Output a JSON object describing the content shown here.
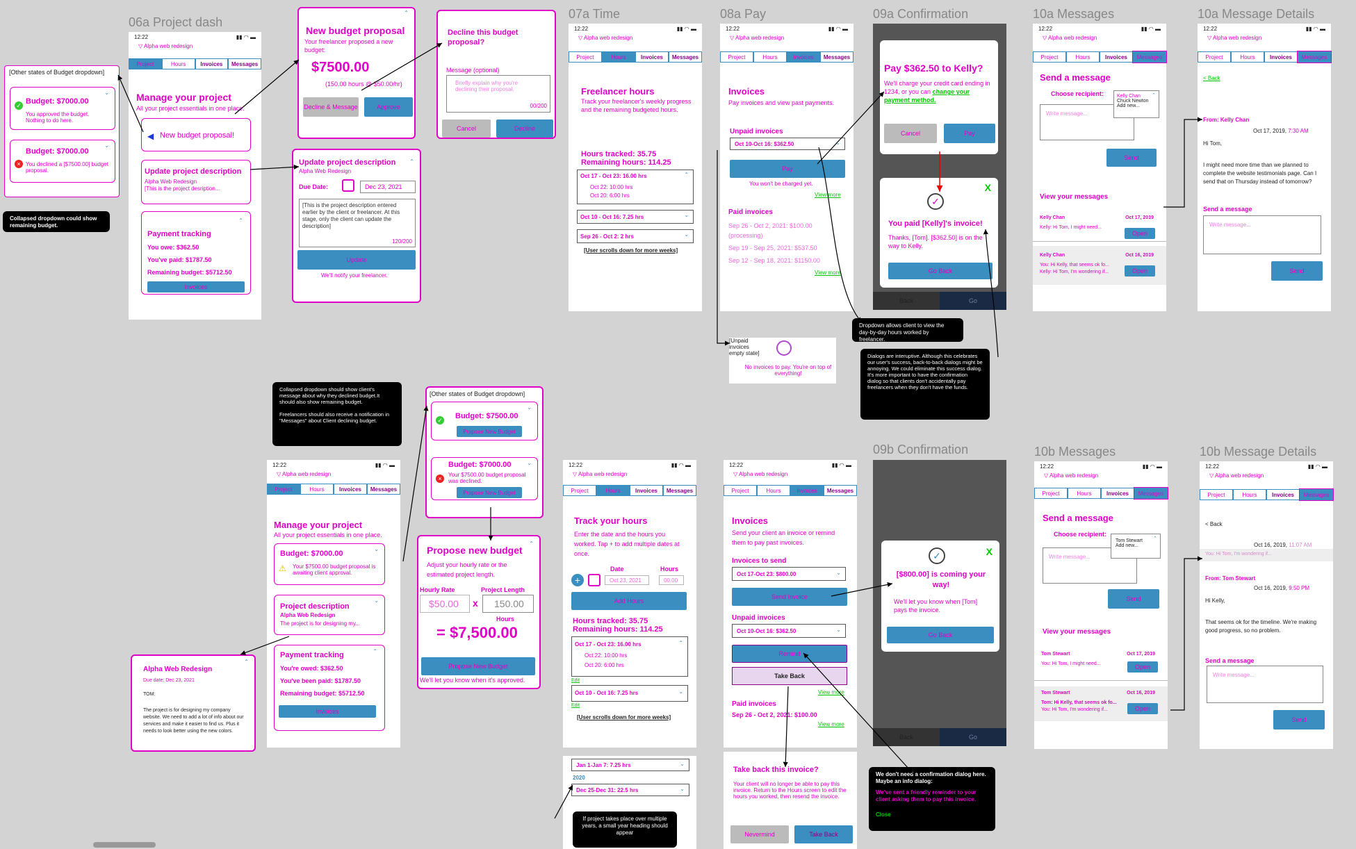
{
  "frames": {
    "f06a": "06a Project dash",
    "f07a": "07a Time",
    "f08a": "08a Pay",
    "f09a": "09a Confirmation",
    "f10a_msg": "10a Messages",
    "f10a_det": "10a Message Details",
    "f09b": "09b Confirmation",
    "f10b_msg": "10b Messages",
    "f10b_det": "10b Message Details"
  },
  "common": {
    "time": "12:22",
    "project": "Alpha web redesign",
    "project_cap": "Alpha Web Redesign",
    "tab_project": "Project",
    "tab_hours": "Hours",
    "tab_invoices": "Invoices",
    "tab_messages": "Messages"
  },
  "budget_states": {
    "title": "[Other states of Budget dropdown]",
    "b1": "Budget: $7000.00",
    "b1_msg": "You approved the budget. Nothing to do here.",
    "b2": "Budget: $7000.00",
    "b2_msg": "You declined a [$7500.00] budget proposal.",
    "note": "Collapsed dropdown could show remaining budget."
  },
  "dash": {
    "title": "Manage your project",
    "sub": "All your project essentials in one place.",
    "new_budget": "New budget proposal!",
    "update_title": "Update project description",
    "update_sub": "Alpha Web Redesign",
    "update_desc": "[This is the project desription...",
    "pay_title": "Payment tracking",
    "you_owe": "You owe: $362.50",
    "you_paid": "You've paid: $1787.50",
    "remaining": "Remaining budget: $5712.50",
    "invoices_btn": "Invoices"
  },
  "nbp": {
    "title": "New budget proposal",
    "sub": "Your freelancer proposed a new budget:",
    "amount": "$7500.00",
    "detail": "(150.00 hours @ $50.00/hr)",
    "decline": "Decline & Message",
    "approve": "Approve"
  },
  "decline": {
    "title": "Decline this budget proposal?",
    "label": "Message (optional)",
    "placeholder": "Briefly explain why you're declining their proposal.",
    "count": "00/200",
    "cancel": "Cancel",
    "decline": "Decline"
  },
  "upd": {
    "title": "Update project description",
    "sub": "Alpha Web Redesign",
    "due_label": "Due Date:",
    "due": "Dec 23, 2021",
    "desc": "[This is the project description entered earlier by the client or freelancer. At this stage, only the client can update the description]",
    "count": "120/200",
    "btn": "Update",
    "foot": "We'll notify your freelancer."
  },
  "time_a": {
    "title": "Freelancer hours",
    "sub": "Track your freelancer's weekly progress and the remaining budgeted hours.",
    "tracked": "Hours tracked: 35.75",
    "remaining": "Remaining hours: 114.25",
    "w1": "Oct 17 - Oct 23: 16.00 hrs",
    "w1a": "Oct 22: 10:00 hrs",
    "w1b": "Oct 20:  6:00 hrs",
    "w2": "Oct 10 - Oct 16:  7.25 hrs",
    "w3": "Sep 26 - Oct 2:  2 hrs",
    "scroll": "[User scrolls down for more weeks]"
  },
  "pay_a": {
    "title": "Invoices",
    "sub": "Pay invoices and view past payments.",
    "unpaid": "Unpaid invoices",
    "sel": "Oct 10-Oct 16: $362.50",
    "pay": "Pay",
    "nocharge": "You won't be charged yet.",
    "viewmore": "View more",
    "paid": "Paid invoices",
    "p1": "Sep 26 - Oct 2, 2021: $100.00",
    "p1b": "(processing)",
    "p2": "Sep 19 - Sep 25, 2021: $537.50",
    "p3": "Sep 12 - Sep 18, 2021: $1150.00",
    "viewmore2": "View more"
  },
  "empty": {
    "label": "[Unpaid invoices empty state]",
    "msg": "No invoices to pay. You're on top of everything!"
  },
  "conf_a": {
    "title": "Pay $362.50 to Kelly?",
    "body": "We'll charge your credit card ending in 1234, or you can",
    "link": "change your payment method.",
    "cancel": "Cancel",
    "pay": "Pay",
    "x": "X",
    "paid_title": "You paid [Kelly]'s invoice!",
    "paid_body": "Thanks, [Tom]. [$362.50] is on the way to Kelly.",
    "goback": "Go Back",
    "back": "Back",
    "go": "Go"
  },
  "note_dd": "Dropdown allows client to view the day-by-day hours worked by freelancer.",
  "note_dialogs": "Dialogs are interuptive. Although this celebrates our user's success, back-to-back dialogs might be annoying. We could eliminate this success dialog. It's more important to have the confirmation dialog so that clients don't accidentally pay freelancers when they don't have the funds.",
  "msg_a": {
    "title": "Send a message",
    "choose": "Choose recipient:",
    "placeholder": "Write message...",
    "r1": "Kelly Chan",
    "r2": "Chuck Newton",
    "r3": "Add new...",
    "send": "Send",
    "view": "View your messages",
    "m1_name": "Kelly Chan",
    "m1_date": "Oct 17, 2019",
    "m1_text": "Kelly: Hi Tom, I might need...",
    "open": "Open",
    "m2_name": "Kelly Chan",
    "m2_date": "Oct 16, 2019",
    "m2_a": "You: Hi Kelly, that seems ok fo...",
    "m2_b": "Kelly: Hi Tom, I'm wondering if..."
  },
  "det_a": {
    "back": "< Back",
    "from": "From: Kelly Chan",
    "date": "Oct 17, 2019,",
    "time": "7:30 AM",
    "greet": "Hi Tom,",
    "body": "I might need more time than we planned to complete the website testimonials page. Can I send that on Thursday instead of tomorrow?",
    "send_title": "Send a message",
    "placeholder": "Write message...",
    "send": "Send"
  },
  "note_collapsed": "Collapsed dropdown should show client's message about why they declined budget.It should also show remaining budget.\n\nFreelancers should also receive a notification in \"Messages\" about Client declining budget.",
  "fl_states": {
    "title": "[Other states of Budget dropdown]",
    "b1": "Budget: $7500.00",
    "btn": "Propose New Budget",
    "b2": "Budget: $7000.00",
    "b2_msg": "Your $7500.00 budget proposal was declined."
  },
  "fl_dash": {
    "title": "Manage your project",
    "sub": "All your project essentials in one place.",
    "budget": "Budget: $7000.00",
    "budget_msg": "Your $7500.00 budget proposal is awaiting client approval.",
    "desc_title": "Project description",
    "desc_sub": "Alpha Web Redesign",
    "desc_text": "The project is for designing my...",
    "pay_title": "Payment tracking",
    "owed": "You're owed: $362.50",
    "paid": "You've been paid: $1787.50",
    "remaining": "Remaining budget: $5712.50",
    "invoices": "Invoices"
  },
  "propose": {
    "title": "Propose new budget",
    "sub": "Adjust your hourly rate or the estimated project length.",
    "rate_label": "Hourly Rate",
    "rate": "$50.00",
    "x": "x",
    "len_label": "Project Length",
    "len": "150.00",
    "hours": "Hours",
    "total": "= $7,500.00",
    "btn": "Propose New Budget",
    "foot": "We'll let you know when it's approved."
  },
  "desc_exp": {
    "title": "Alpha Web Redesign",
    "due": "Due date: Dec 23, 2021",
    "tom": "TOM:",
    "body": "The project is for designing my company website. We need to add a lot of info about our services and make it easier to find us. Plus it needs to look better using the new colors."
  },
  "track": {
    "title": "Track your hours",
    "sub": "Enter the date and the hours you worked. Tap + to add multiple dates at once.",
    "date_label": "Date",
    "hours_label": "Hours",
    "date": "Oct 23, 2021",
    "hours": "00.00",
    "add": "Add Hours",
    "tracked": "Hours tracked: 35.75",
    "remaining": "Remaining hours: 114.25",
    "w1": "Oct 17 - Oct 23: 16.00 hrs",
    "w1a": "Oct 22: 10:00 hrs",
    "w1b": "Oct 20:  6:00 hrs",
    "edit": "Edit",
    "w2": "Oct 10 - Oct 16: 7.25 hrs",
    "edit2": "Edit",
    "scroll": "[User scrolls down for more weeks]"
  },
  "years": {
    "j": "Jan 1-Jan 7: 7.25 hrs",
    "y": "2020",
    "d": "Dec 25-Dec 31: 22.5 hrs",
    "note": "If project takes place over multiple years, a small year heading should appear"
  },
  "inv_b": {
    "title": "Invoices",
    "sub": "Send your client an invoice or remind them to pay past invoices.",
    "send_h": "Invoices to send",
    "send_sel": "Oct 17-Oct 23: $800.00",
    "send_btn": "Send Invoice",
    "unpaid_h": "Unpaid invoices",
    "unpaid_sel": "Oct 10-Oct 16: $362.50",
    "remind": "Remind",
    "takeback": "Take Back",
    "viewmore": "View more",
    "paid_h": "Paid invoices",
    "paid_1": "Sep 26 - Oct 2, 2021: $100.00",
    "viewmore2": "View more"
  },
  "takeback": {
    "title": "Take back this invoice?",
    "body": "Your client will no longer be able to pay this invoice. Return to the Hours screen to edit the hours you worked, then resend the invoice.",
    "never": "Nevermind",
    "take": "Take Back"
  },
  "note_info": {
    "l1": "We don't need a confirmation dialog here. Maybe an info dialog:",
    "l2": "We've sent a friendly reminder to your client asking them to pay this invoice.",
    "close": "Close"
  },
  "conf_b": {
    "title": "[$800.00] is coming your way!",
    "body": "We'll let you know when [Tom] pays the invoice.",
    "goback": "Go Back",
    "x": "X",
    "back": "Back",
    "go": "Go"
  },
  "msg_b": {
    "title": "Send a message",
    "choose": "Choose recipient:",
    "placeholder": "Write message...",
    "r1": "Tom Stewart",
    "r2": "Add new...",
    "send": "Send",
    "view": "View your messages",
    "m1_name": "Tom Stewart",
    "m1_date": "Oct 17, 2019",
    "m1_text": "You: Hi Tom, I might need...",
    "open": "Open",
    "m2_name": "Tom Stewart",
    "m2_date": "Oct 16, 2019",
    "m2_a": "Tom: Hi Kelly, that seems ok fo...",
    "m2_b": "You: Hi Tom, I'm wondering if..."
  },
  "det_b": {
    "back": "< Back",
    "date1": "Oct 16, 2019,",
    "time1": "11:07 AM",
    "prev": "You: Hi Tom, I'm wondering if...",
    "from": "From: Tom Stewart",
    "date2": "Oct 16, 2019,",
    "time2": "9:50 PM",
    "greet": "Hi Kelly,",
    "body": "That seems ok for the timeline. We're making good progress, so no problem.",
    "send_title": "Send a message",
    "placeholder": "Write message...",
    "send": "Send"
  },
  "colors": {
    "magenta": "#e000c8",
    "blue": "#3a8fc0",
    "green": "#00c800",
    "red": "#e00000"
  }
}
